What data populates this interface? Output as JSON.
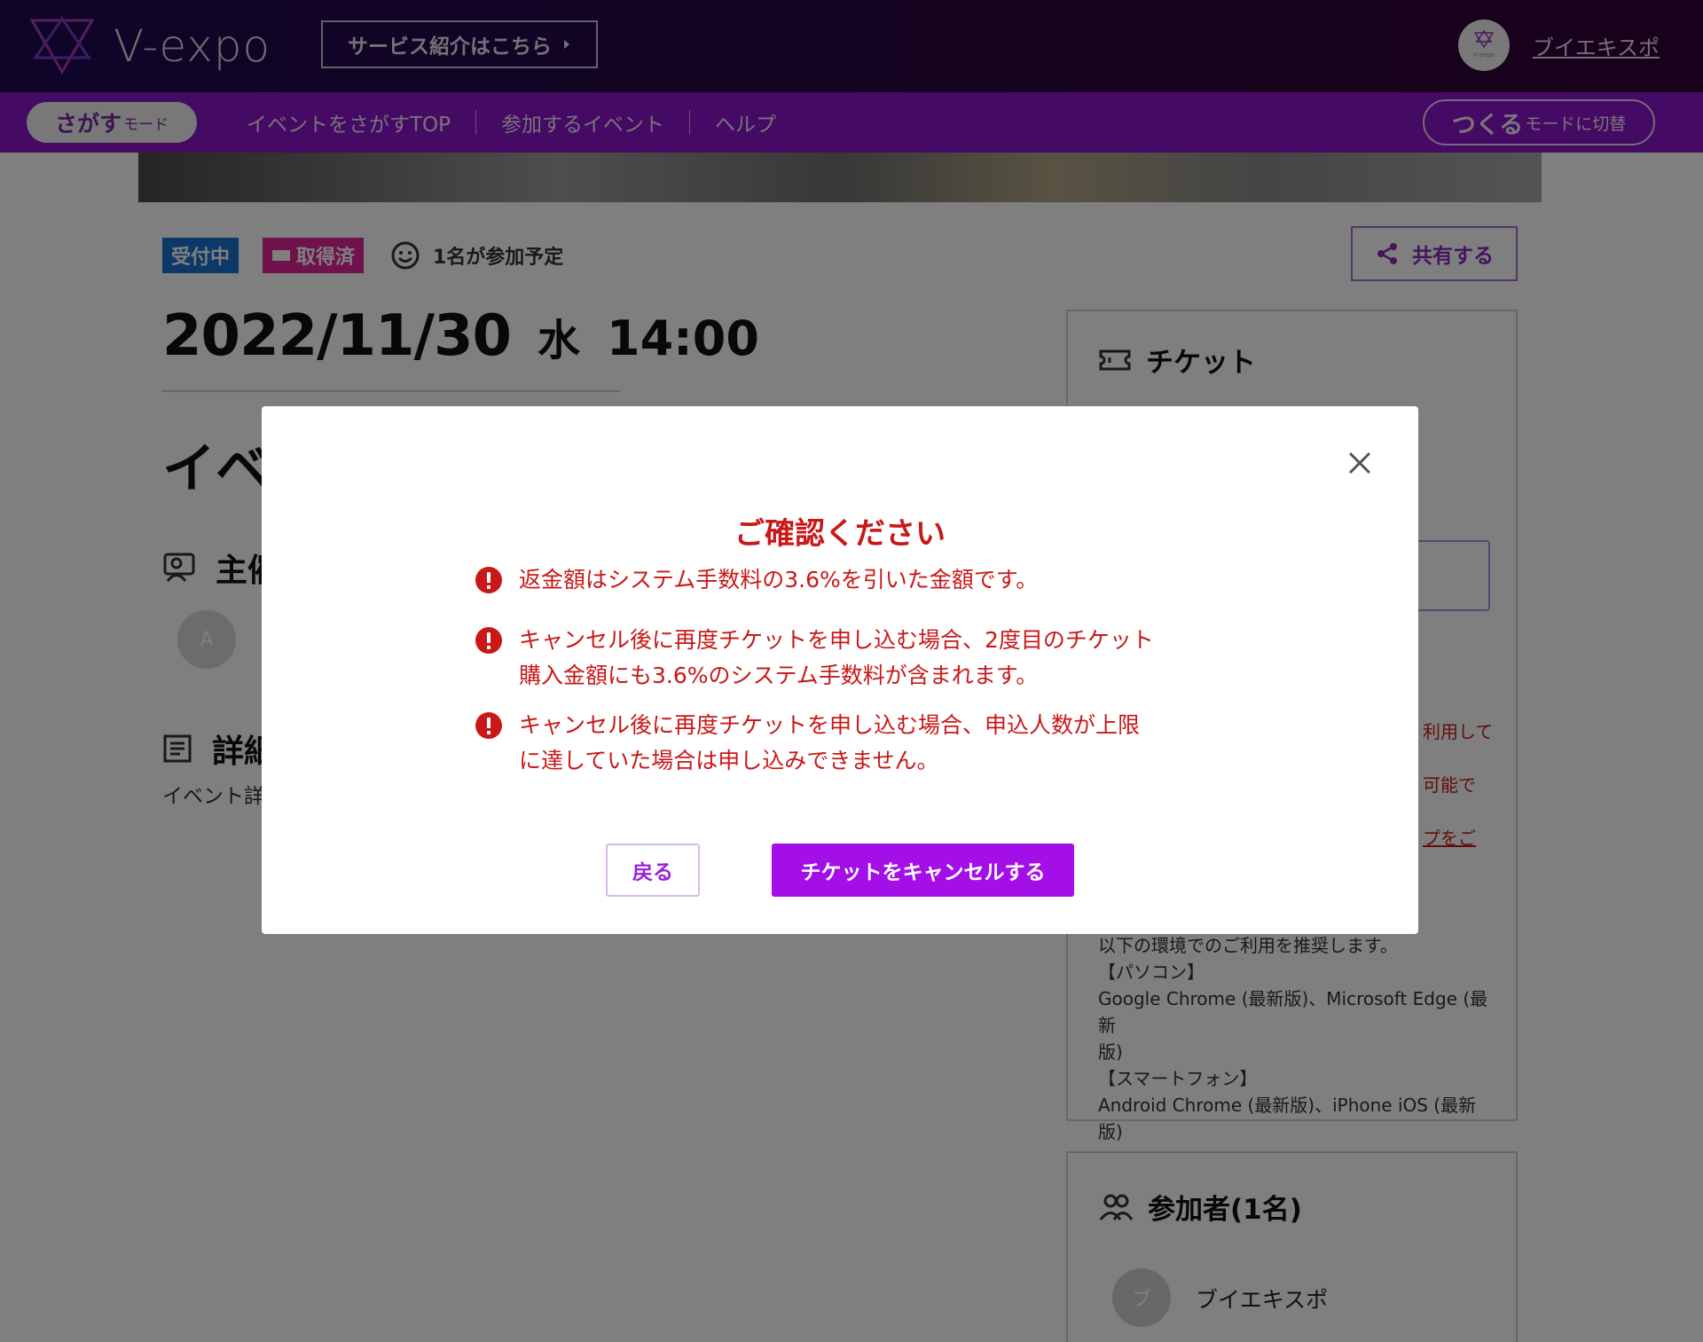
{
  "header": {
    "logo_text": "V-expo",
    "service_button": "サービス紹介はこちら",
    "avatar_label": "V-expo",
    "user_name": "ブイエキスポ"
  },
  "nav": {
    "mode_main": "さがす",
    "mode_sub": "モード",
    "links": [
      "イベントをさがすTOP",
      "参加するイベント",
      "ヘルプ"
    ],
    "switch_main": "つくる",
    "switch_sub": "モードに切替"
  },
  "event": {
    "badge_open": "受付中",
    "badge_acquired": "取得済",
    "participants": "1名が参加予定",
    "share": "共有する",
    "date": "2022/11/30",
    "weekday": "水",
    "time": "14:00",
    "title_partial": "イベ",
    "organizer_heading_partial": "主催",
    "organizer_initial": "A",
    "details_heading_partial": "詳細",
    "details_text_partial": "イベント詳"
  },
  "ticket_panel": {
    "heading": "チケット",
    "red_line_1": "利用して",
    "red_line_2": "可能で",
    "red_line_3": "プをご",
    "env_lines": [
      "以下の環境でのご利用を推奨します。",
      "【パソコン】",
      "Google Chrome (最新版)、Microsoft Edge (最新",
      "版)",
      "【スマートフォン】",
      "Android Chrome (最新版)、iPhone iOS (最新版)"
    ]
  },
  "attendees": {
    "heading": "参加者(1名)",
    "initial": "ブ",
    "name": "ブイエキスポ"
  },
  "modal": {
    "title": "ご確認ください",
    "warnings": [
      [
        "返金額はシステム手数料の3.6%を引いた金額です。"
      ],
      [
        "キャンセル後に再度チケットを申し込む場合、2度目のチケット",
        "購入金額にも3.6%のシステム手数料が含まれます。"
      ],
      [
        "キャンセル後に再度チケットを申し込む場合、申込人数が上限",
        "に達していた場合は申し込みできません。"
      ]
    ],
    "back_button": "戻る",
    "cancel_button": "チケットをキャンセルする"
  },
  "colors": {
    "accent": "#a40fe8",
    "warning": "#c81818",
    "nav": "#8a14c8"
  }
}
